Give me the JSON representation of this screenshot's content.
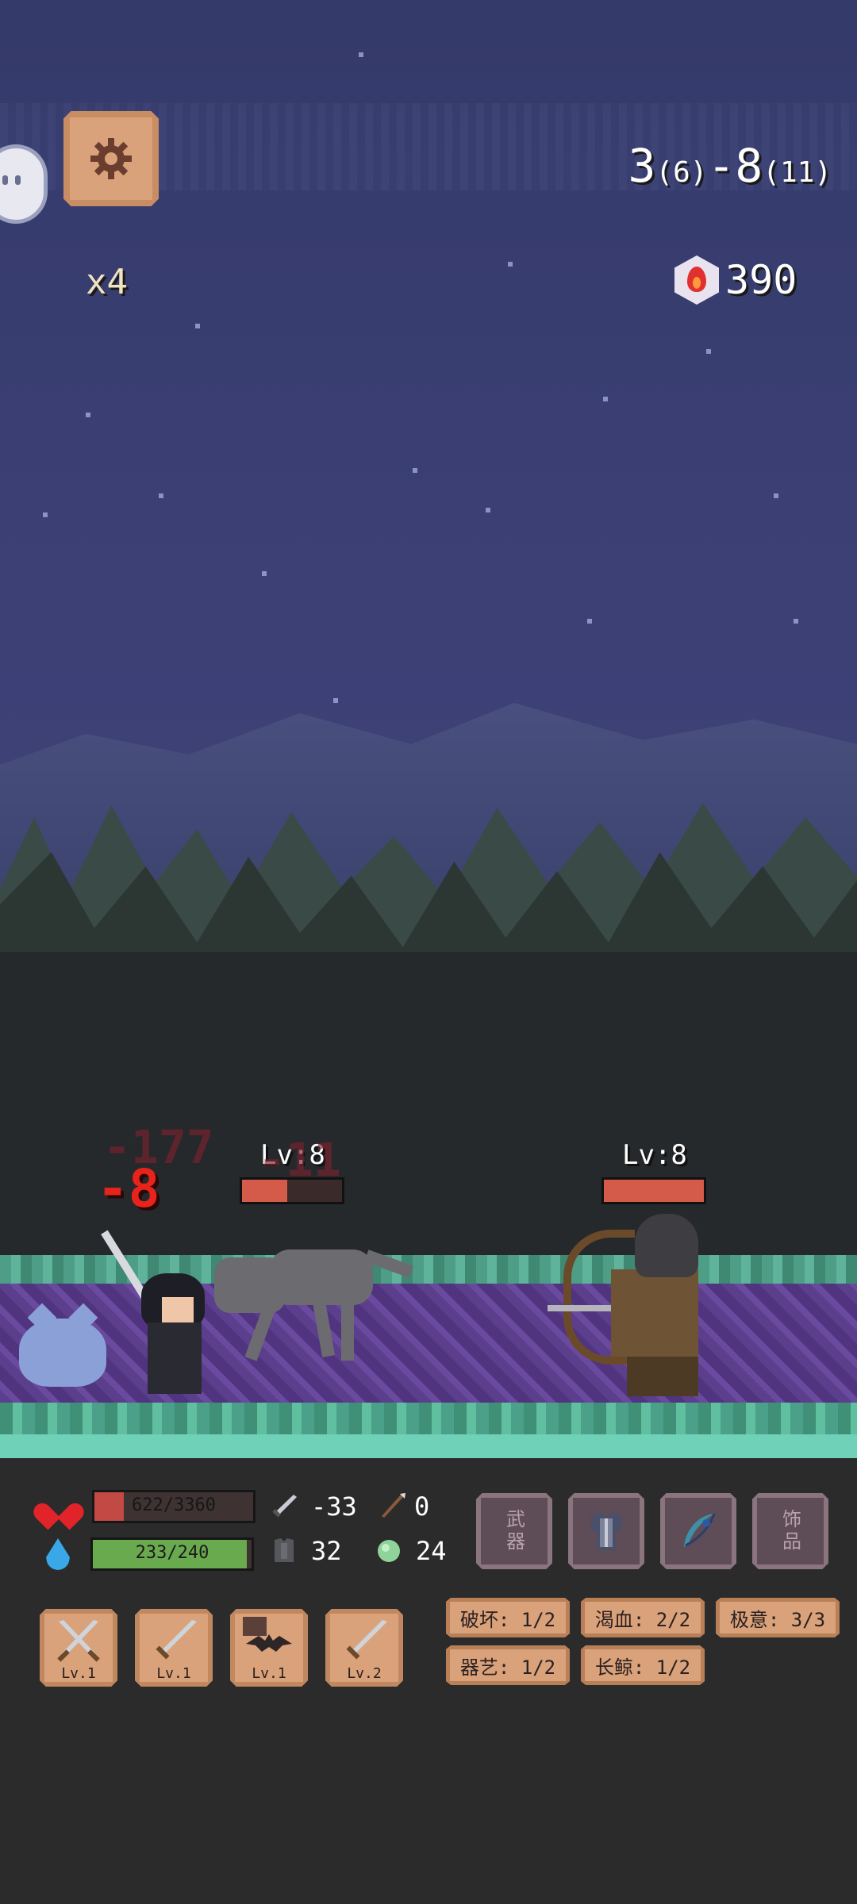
{
  "hud": {
    "speed_label": "x4",
    "stage_main_a": "3",
    "stage_sub_a": "(6)",
    "stage_sep": "-",
    "stage_main_b": "8",
    "stage_sub_b": "(11)",
    "soul_count": "390"
  },
  "combat": {
    "wolf_level": "Lv:8",
    "wolf_hp_fraction": 0.45,
    "archer_level": "Lv:8",
    "archer_hp_fraction": 1.0,
    "damage_main": "-8",
    "damage_faded_1": "-177",
    "damage_faded_2": "-11"
  },
  "player": {
    "hp_text": "622/3360",
    "hp_fraction": 0.185,
    "mp_text": "233/240",
    "mp_fraction": 0.97,
    "attack": "-33",
    "crit": "0",
    "defense": "32",
    "regen": "24"
  },
  "equipment": [
    {
      "icon": "weapon-slot-empty",
      "label": "武器"
    },
    {
      "icon": "armor-icon",
      "label": ""
    },
    {
      "icon": "feather-icon",
      "label": ""
    },
    {
      "icon": "accessory-slot-empty",
      "label": "饰品"
    }
  ],
  "skills": [
    {
      "icon": "crossed-swords-icon",
      "level": "Lv.1"
    },
    {
      "icon": "sword-icon",
      "level": "Lv.1"
    },
    {
      "icon": "bat-icon",
      "level": "Lv.1"
    },
    {
      "icon": "sword-icon",
      "level": "Lv.2"
    }
  ],
  "traits": [
    "破坏: 1/2",
    "渴血: 2/2",
    "极意: 3/3",
    "器艺: 1/2",
    "长鲸: 1/2"
  ],
  "colors": {
    "sky": "#3b3f74",
    "panel": "#2b2b2b",
    "button_tan": "#d9a27a",
    "damage_red": "#e8231c",
    "hp_red": "#c34a44",
    "mp_green": "#6aaa4e"
  }
}
